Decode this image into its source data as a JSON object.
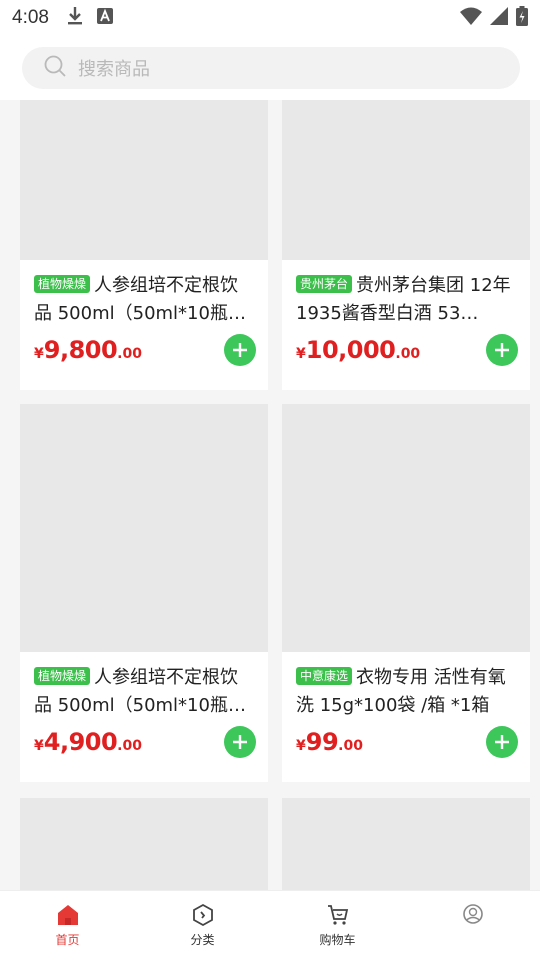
{
  "status_bar": {
    "time": "4:08",
    "left_icons": [
      "download-icon",
      "a-notification-icon"
    ],
    "right_icons": [
      "wifi-icon",
      "signal-icon",
      "battery-icon"
    ]
  },
  "search": {
    "placeholder": "搜索商品",
    "icon": "search-icon"
  },
  "products": [
    {
      "tag": "植物燥燥",
      "title": "人参组培不定根饮品 500ml（50ml*10瓶…",
      "currency": "¥",
      "price_int": "9,800",
      "price_dec": ".00"
    },
    {
      "tag": "贵州茅台",
      "title": "贵州茅台集团 12年1935酱香型白酒 53…",
      "currency": "¥",
      "price_int": "10,000",
      "price_dec": ".00"
    },
    {
      "tag": "植物燥燥",
      "title": "人参组培不定根饮品 500ml（50ml*10瓶…",
      "currency": "¥",
      "price_int": "4,900",
      "price_dec": ".00"
    },
    {
      "tag": "中意康选",
      "title": "衣物专用 活性有氧洗 15g*100袋 /箱 *1箱",
      "currency": "¥",
      "price_int": "99",
      "price_dec": ".00"
    }
  ],
  "bottom_nav": [
    {
      "label": "首页",
      "icon": "home-icon",
      "active": true
    },
    {
      "label": "分类",
      "icon": "category-icon",
      "active": false
    },
    {
      "label": "购物车",
      "icon": "cart-icon",
      "active": false
    },
    {
      "label": "",
      "icon": "profile-icon",
      "active": false
    }
  ],
  "colors": {
    "accent_red": "#e53935",
    "price_red": "#e02020",
    "tag_green": "#3cbf4b",
    "add_green": "#3dc65a"
  }
}
